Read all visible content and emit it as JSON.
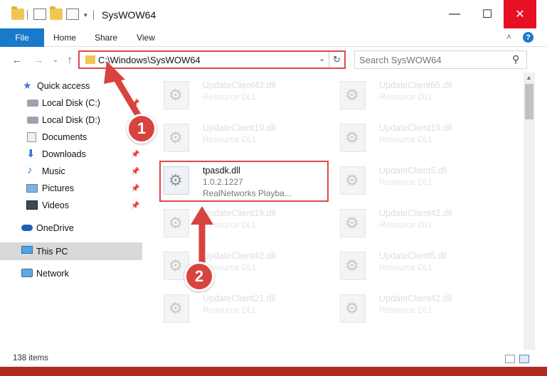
{
  "window": {
    "title": "SysWOW64",
    "controls": {
      "minimize": "—",
      "maximize": "☐",
      "close": "✕"
    }
  },
  "ribbon": {
    "tabs": [
      "File",
      "Home",
      "Share",
      "View"
    ],
    "help": "?",
    "collapse": "˄"
  },
  "navigation": {
    "back": "←",
    "forward": "→",
    "dropdown": "⌄",
    "up": "↑",
    "address": "C:\\Windows\\SysWOW64",
    "address_drop": "⌄",
    "refresh": "↻",
    "search_placeholder": "Search SysWOW64",
    "search_icon": "⚲"
  },
  "sidebar": {
    "items": [
      {
        "label": "Quick access",
        "icon": "star-icon",
        "pinned": false
      },
      {
        "label": "Local Disk (C:)",
        "icon": "drive-icon",
        "pinned": true
      },
      {
        "label": "Local Disk (D:)",
        "icon": "drive-icon",
        "pinned": true
      },
      {
        "label": "Documents",
        "icon": "documents-icon",
        "pinned": true
      },
      {
        "label": "Downloads",
        "icon": "downloads-icon",
        "pinned": true
      },
      {
        "label": "Music",
        "icon": "music-icon",
        "pinned": true
      },
      {
        "label": "Pictures",
        "icon": "pictures-icon",
        "pinned": true
      },
      {
        "label": "Videos",
        "icon": "videos-icon",
        "pinned": true
      },
      {
        "label": "OneDrive",
        "icon": "cloud-icon",
        "pinned": false
      },
      {
        "label": "This PC",
        "icon": "computer-icon",
        "pinned": false,
        "selected": true
      },
      {
        "label": "Network",
        "icon": "network-icon",
        "pinned": false
      }
    ],
    "pin_glyph": "📌"
  },
  "files": {
    "left": [
      {
        "name": "UpdateClient42.dll",
        "desc": "Resource DLL"
      },
      {
        "name": "UpdateClient19.dll",
        "desc": "Resource DLL"
      },
      {
        "name": "tpasdk.dll",
        "desc": "1.0.2.1227",
        "desc2": "RealNetworks Playba...",
        "focus": true
      },
      {
        "name": "UpdateClient19.dll",
        "desc": "Resource DLL"
      },
      {
        "name": "UpdateClient42.dll",
        "desc": "Resource DLL"
      },
      {
        "name": "UpdateClient21.dll",
        "desc": "Resource DLL"
      }
    ],
    "right": [
      {
        "name": "UpdateClient65.dll",
        "desc": "Resource DLL"
      },
      {
        "name": "UpdateClient19.dll",
        "desc": "Resource DLL"
      },
      {
        "name": "UpdateClient5.dll",
        "desc": "Resource DLL"
      },
      {
        "name": "UpdateClient42.dll",
        "desc": "Resource DLL"
      },
      {
        "name": "UpdateClient5.dll",
        "desc": "Resource DLL"
      },
      {
        "name": "UpdateClient42.dll",
        "desc": "Resource DLL"
      }
    ]
  },
  "status": {
    "items": "138 items"
  },
  "annotations": {
    "step1": "1",
    "step2": "2",
    "color": "#d7443e"
  }
}
